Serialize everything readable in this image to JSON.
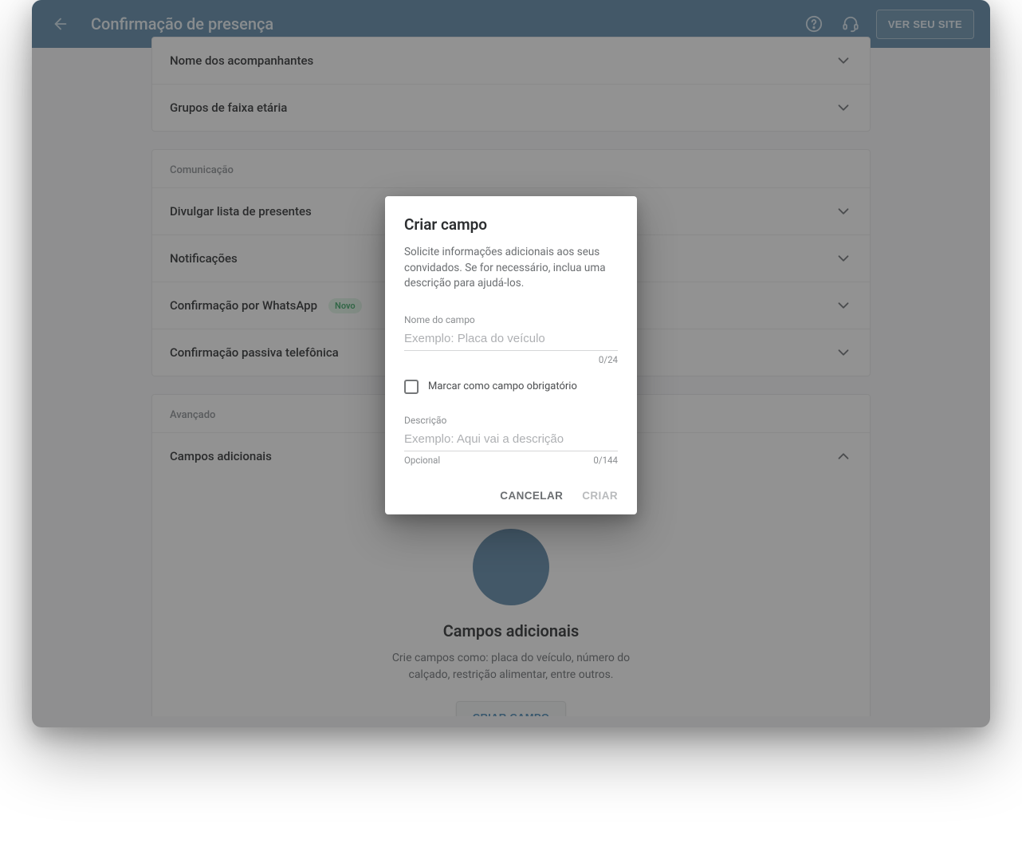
{
  "topbar": {
    "title": "Confirmação de presença",
    "view_site": "VER SEU SITE"
  },
  "section1": {
    "row_companions": "Nome dos acompanhantes",
    "row_age_groups": "Grupos de faixa etária"
  },
  "section2": {
    "header": "Comunicação",
    "row_giftlist": "Divulgar lista de presentes",
    "row_notifications": "Notificações",
    "row_whatsapp": "Confirmação por WhatsApp",
    "badge_new": "Novo",
    "row_passive_phone": "Confirmação passiva telefônica"
  },
  "section3": {
    "header": "Avançado",
    "row_additional_fields": "Campos adicionais",
    "empty_title": "Campos adicionais",
    "empty_desc": "Crie campos como: placa do veículo, número do calçado, restrição alimentar, entre outros.",
    "create_button": "CRIAR CAMPO"
  },
  "dialog": {
    "title": "Criar campo",
    "desc": "Solicite informações adicionais aos seus convidados. Se for necessário, inclua uma descrição para ajudá-los.",
    "name_label": "Nome do campo",
    "name_placeholder": "Exemplo: Placa do veículo",
    "name_counter": "0/24",
    "required_label": "Marcar como campo obrigatório",
    "desc_label": "Descrição",
    "desc_placeholder": "Exemplo: Aqui vai a descrição",
    "desc_hint": "Opcional",
    "desc_counter": "0/144",
    "cancel": "CANCELAR",
    "create": "CRIAR"
  }
}
